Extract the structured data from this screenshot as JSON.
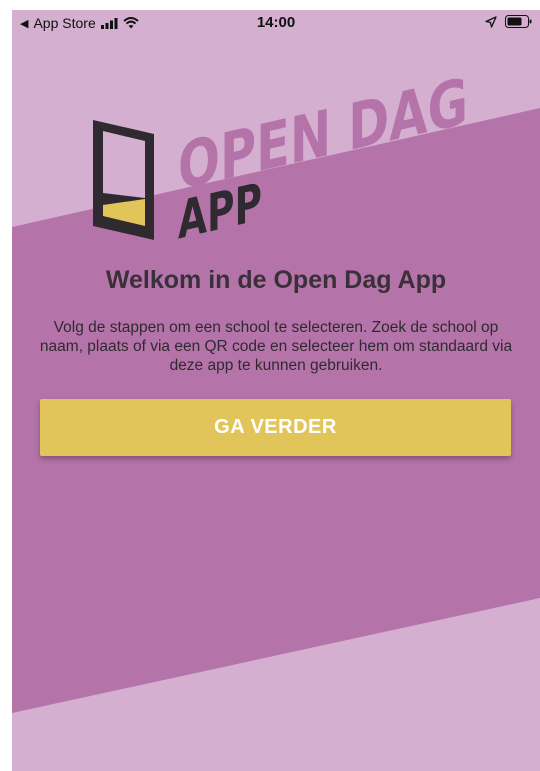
{
  "status_bar": {
    "back_label": "App Store",
    "time": "14:00",
    "icons": [
      "back-triangle-icon",
      "signal-icon",
      "wifi-icon",
      "location-arrow-icon",
      "battery-icon"
    ]
  },
  "logo": {
    "line1": "OPEN DAG",
    "line2": "APP",
    "icon": "tablet-icon"
  },
  "welcome": {
    "title": "Welkom in de Open Dag App",
    "description": "Volg de stappen om een school te selecteren. Zoek de school op naam, plaats of via een QR code en selecteer hem om standaard via deze app te kunnen gebruiken."
  },
  "actions": {
    "continue_label": "GA VERDER"
  },
  "colors": {
    "background_light": "#d4afd0",
    "band": "#b574a9",
    "logo_text": "#b574a9",
    "logo_dark": "#2f2a30",
    "accent_yellow": "#e2c55a",
    "button_text": "#ffffff"
  }
}
